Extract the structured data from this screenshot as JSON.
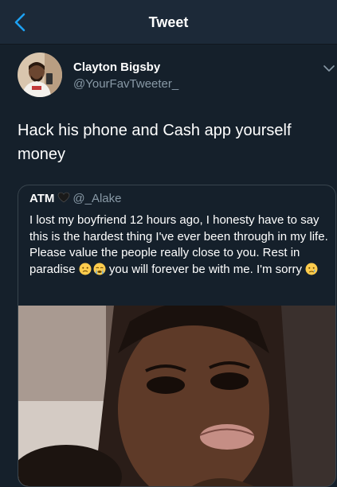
{
  "nav": {
    "title": "Tweet"
  },
  "tweet": {
    "author_name": "Clayton Bigsby",
    "author_handle": "@YourFavTweeter_",
    "text": "Hack his phone and Cash app yourself money"
  },
  "quoted_tweet": {
    "author_name": "ATM",
    "author_handle": "@_Alake",
    "text_part1": "I lost my boyfriend 12 hours ago, I honesty have to say this is the hardest thing I've ever been through in my life. Please value the people really close to you. Rest in paradise ",
    "text_part2": " you will forever be with me. I'm sorry "
  },
  "icons": [
    "back-arrow-icon",
    "chevron-down-icon",
    "black-heart-icon",
    "face-emoji-icon",
    "crying-emoji-icon"
  ],
  "colors": {
    "background": "#15202b",
    "navbar": "#1c2938",
    "accent": "#1da1f2",
    "secondary_text": "#8899a6",
    "border": "#38444d"
  }
}
